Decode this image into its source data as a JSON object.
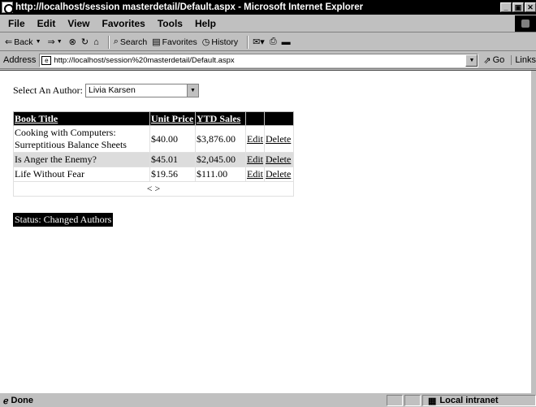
{
  "window": {
    "title": "http://localhost/session masterdetail/Default.aspx - Microsoft Internet Explorer",
    "buttons": [
      "_",
      "▣",
      "✕"
    ]
  },
  "menu": [
    "File",
    "Edit",
    "View",
    "Favorites",
    "Tools",
    "Help"
  ],
  "toolbar": {
    "back": "Back",
    "forward": "⇒",
    "search": "Search",
    "favorites": "Favorites",
    "history": "History"
  },
  "address": {
    "label": "Address",
    "url": "http://localhost/session%20masterdetail/Default.aspx",
    "go": "Go",
    "links": "Links"
  },
  "page": {
    "author_label": "Select An Author:",
    "author_selected": "Livia Karsen",
    "table": {
      "headers": [
        "Book Title",
        "Unit Price",
        "YTD Sales",
        "",
        ""
      ],
      "rows": [
        {
          "title": "Cooking with Computers: Surreptitious Balance Sheets",
          "price": "$40.00",
          "sales": "$3,876.00",
          "edit": "Edit",
          "delete": "Delete"
        },
        {
          "title": "Is Anger the Enemy?",
          "price": "$45.01",
          "sales": "$2,045.00",
          "edit": "Edit",
          "delete": "Delete"
        },
        {
          "title": "Life Without Fear",
          "price": "$19.56",
          "sales": "$111.00",
          "edit": "Edit",
          "delete": "Delete"
        }
      ],
      "pager_prev": "<",
      "pager_next": ">"
    },
    "status": "Status: Changed Authors"
  },
  "statusbar": {
    "text": "Done",
    "zone": "Local intranet"
  }
}
